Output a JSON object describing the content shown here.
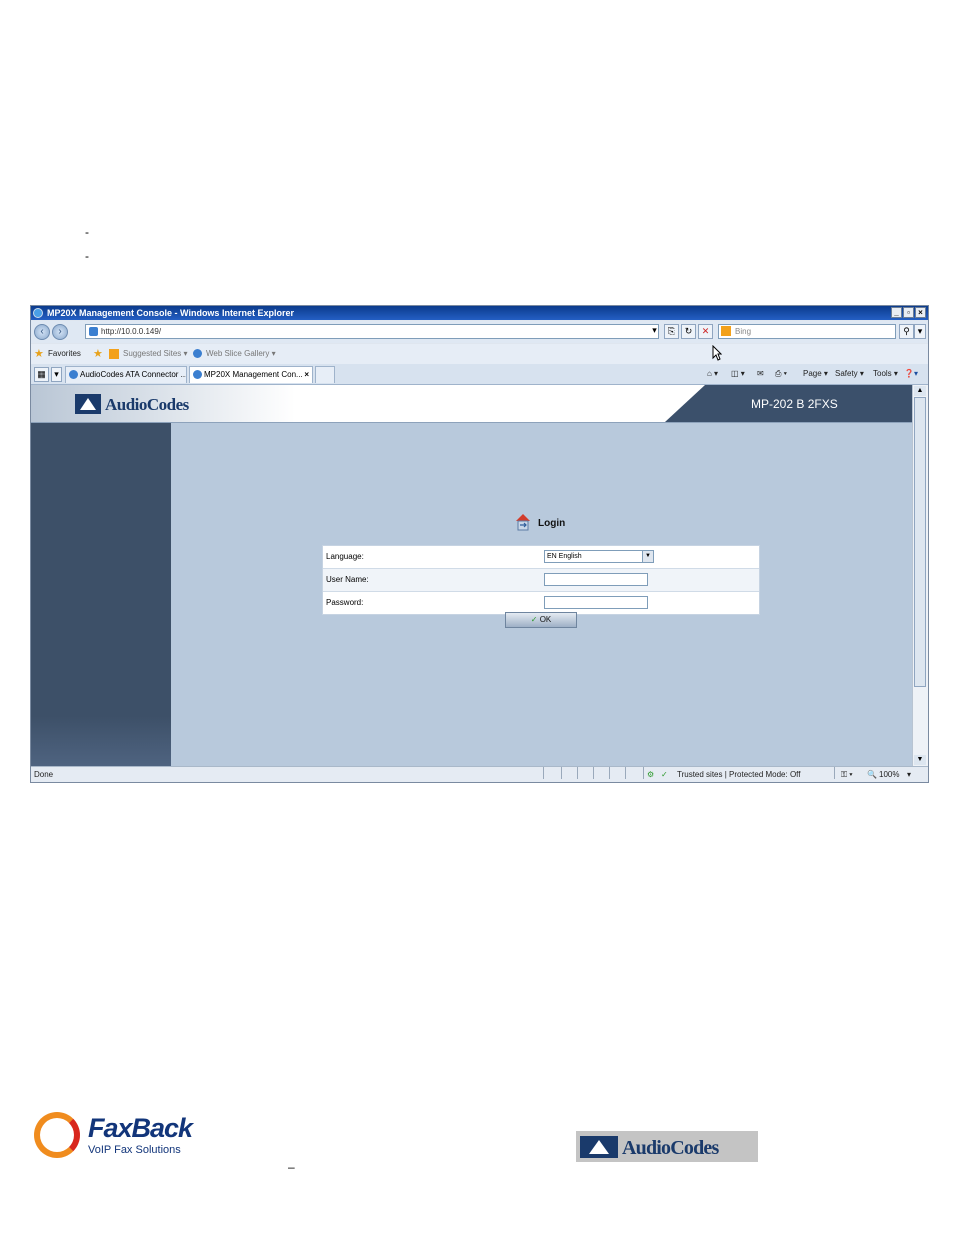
{
  "doc": {
    "bullets": [
      "-",
      "-"
    ],
    "footer_dash": "–"
  },
  "browser": {
    "window_title": "MP20X Management Console - Windows Internet Explorer",
    "address": "http://10.0.0.149/",
    "search_placeholder": "Bing",
    "favorites_label": "Favorites",
    "suggested_sites": "Suggested Sites ▾",
    "web_slice_gallery": "Web Slice Gallery ▾",
    "tabs": [
      {
        "label": "AudioCodes ATA Connector ..."
      },
      {
        "label": "MP20X Management Con..."
      }
    ],
    "commands": {
      "page": "Page ▾",
      "safety": "Safety ▾",
      "tools": "Tools ▾"
    },
    "status": {
      "left": "Done",
      "zone": "Trusted sites | Protected Mode: Off",
      "zoom": "100%"
    }
  },
  "webpage": {
    "brand": "AudioCodes",
    "model": "MP-202 B 2FXS",
    "login_title": "Login",
    "fields": [
      {
        "label": "Language:",
        "value": "EN English"
      },
      {
        "label": "User Name:",
        "value": ""
      },
      {
        "label": "Password:",
        "value": ""
      }
    ],
    "ok_label": "OK"
  },
  "footer": {
    "faxback_name": "FaxBack",
    "faxback_tagline": "VoIP Fax Solutions",
    "audiocodes_name": "AudioCodes"
  }
}
